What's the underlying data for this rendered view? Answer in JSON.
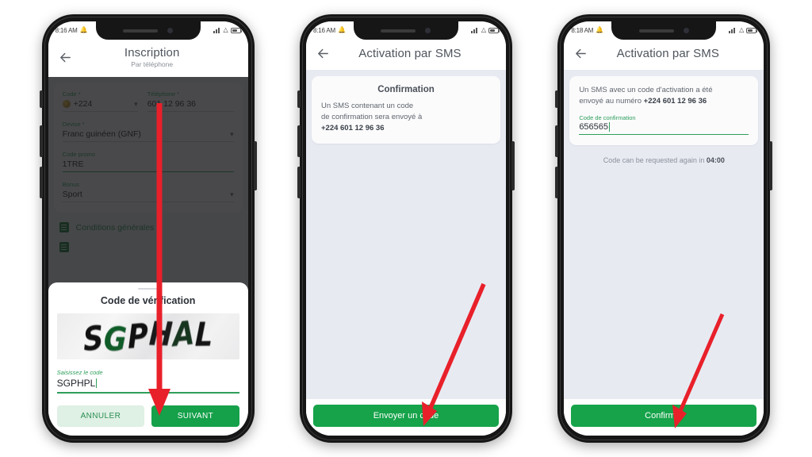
{
  "meta": {
    "accent_green": "#16a34a",
    "label_green": "#2e9e5b",
    "screen_bg": "#e8eaf2",
    "arrow_red": "#e8202a"
  },
  "phone1": {
    "statusbar": {
      "time": "8:16 AM",
      "alarm_icon": "bell-icon",
      "signal_icon": "signal-icon",
      "wifi_icon": "wifi-icon",
      "battery_icon": "battery-icon"
    },
    "appbar": {
      "back_icon": "back-arrow-icon",
      "title": "Inscription",
      "subtitle": "Par téléphone"
    },
    "form": {
      "code_label": "Code *",
      "code_value": "+224",
      "code_chevron": "chevron-down-icon",
      "flag_icon": "flag-icon",
      "tel_label": "Téléphone *",
      "tel_value": "601 12 96 36",
      "devise_label": "Devise *",
      "devise_value": "Franc guinéen (GNF)",
      "devise_chevron": "chevron-down-icon",
      "promo_label": "Code promo",
      "promo_value": "1TRE",
      "bonus_label": "Bonus",
      "bonus_value": "Sport",
      "bonus_chevron": "chevron-down-icon"
    },
    "terms": {
      "icon": "document-icon",
      "label": "Conditions générales"
    },
    "sheet": {
      "title": "Code de vérification",
      "captcha_text": "SGPHAL",
      "input_label": "Saisissez le code",
      "input_value": "SGPHPL",
      "cancel_label": "ANNULER",
      "next_label": "SUIVANT"
    }
  },
  "phone2": {
    "statusbar": {
      "time": "8:16 AM",
      "alarm_icon": "bell-icon",
      "signal_icon": "signal-icon",
      "wifi_icon": "wifi-icon",
      "battery_icon": "battery-icon"
    },
    "appbar": {
      "back_icon": "back-arrow-icon",
      "title": "Activation par SMS"
    },
    "card": {
      "title": "Confirmation",
      "line1": "Un SMS contenant un code",
      "line2": "de confirmation sera envoyé à",
      "phone": "+224 601 12 96 36"
    },
    "cta_label": "Envoyer un code"
  },
  "phone3": {
    "statusbar": {
      "time": "8:18 AM",
      "alarm_icon": "bell-icon",
      "signal_icon": "signal-icon",
      "wifi_icon": "wifi-icon",
      "battery_icon": "battery-icon"
    },
    "appbar": {
      "back_icon": "back-arrow-icon",
      "title": "Activation par SMS"
    },
    "card": {
      "line1": "Un SMS avec un code d'activation a été",
      "line2_pre": "envoyé au numéro ",
      "line2_phone": "+224 601 12 96 36",
      "field_label": "Code de confirmation",
      "field_value": "656565"
    },
    "timer_pre": "Code can be requested again in ",
    "timer_value": "04:00",
    "cta_label": "Confirmer"
  }
}
